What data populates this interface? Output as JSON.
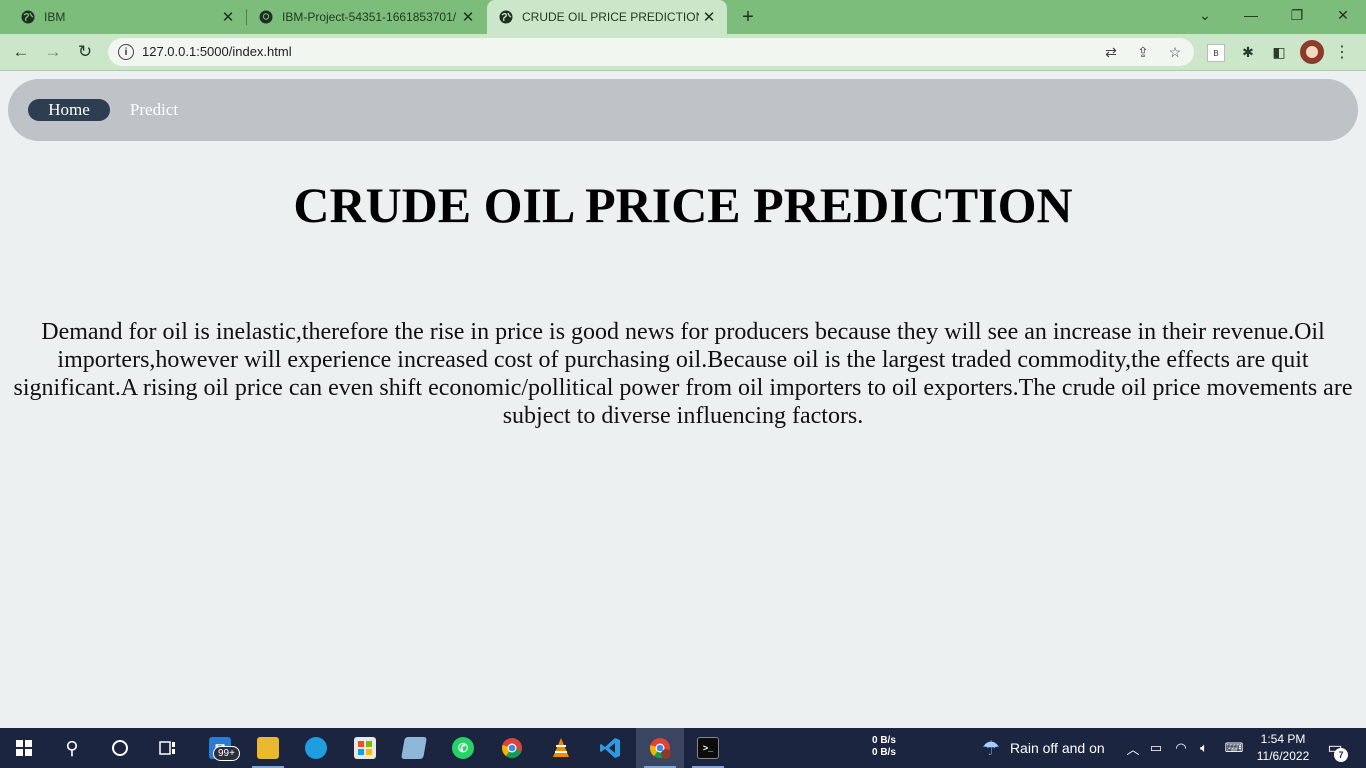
{
  "browser": {
    "tabs": [
      {
        "title": "IBM",
        "favicon": "globe-icon"
      },
      {
        "title": "IBM-Project-54351-1661853701/",
        "favicon": "github-icon"
      },
      {
        "title": "CRUDE OIL PRICE PREDICTION",
        "favicon": "globe-icon",
        "active": true
      }
    ],
    "url": "127.0.0.1:5000/index.html"
  },
  "page": {
    "nav": [
      {
        "label": "Home",
        "active": true
      },
      {
        "label": "Predict",
        "active": false
      }
    ],
    "title": "CRUDE OIL PRICE PREDICTION",
    "description": "Demand for oil is inelastic,therefore the rise in price is good news for producers because they will see an increase in their revenue.Oil importers,however will experience increased cost of purchasing oil.Because oil is the largest traded commodity,the effects are quit significant.A rising oil price can even shift economic/pollitical power from oil importers to oil exporters.The crude oil price movements are subject to diverse influencing factors.",
    "colors": {
      "navbar": "#bdc3c7",
      "nav_active": "#2c3e50",
      "background": "#ecf0f1"
    }
  },
  "extensions": {
    "b_label": "B"
  },
  "taskbar": {
    "mail_badge": "99+",
    "net_up": "0 B/s",
    "net_down": "0 B/s",
    "weather": "Rain off and on",
    "time": "1:54 PM",
    "date": "11/6/2022",
    "notifications": "7"
  }
}
